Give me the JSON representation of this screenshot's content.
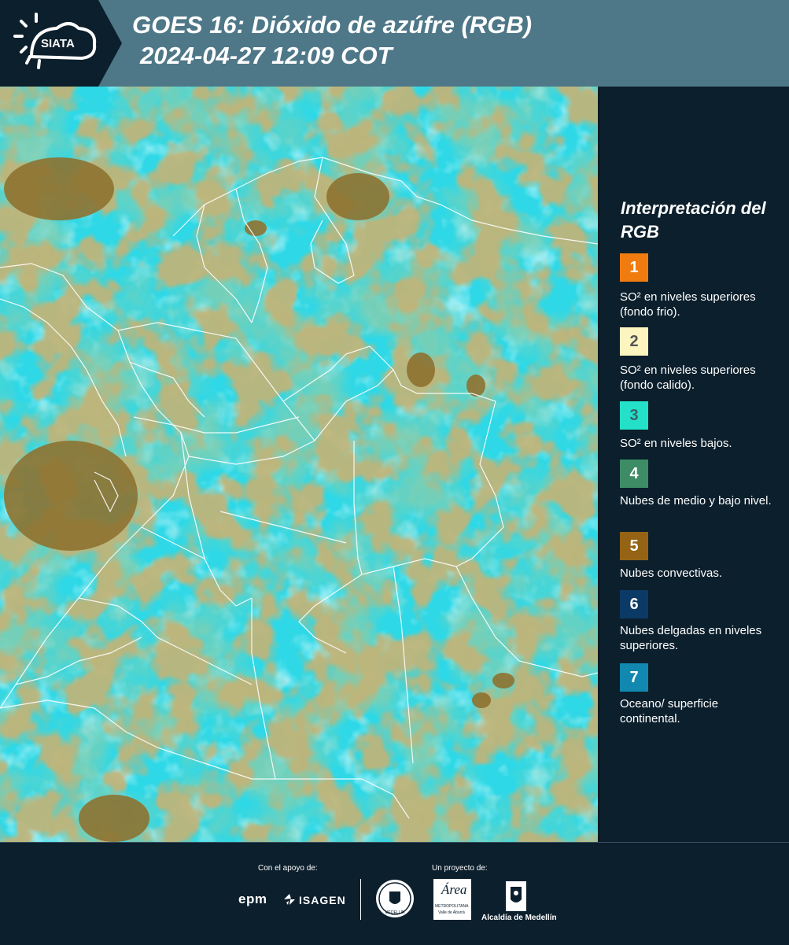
{
  "header": {
    "title_line1": "GOES 16: Dióxido de azúfre (RGB)",
    "title_line2": "2024-04-27 12:09 COT",
    "logo_text": "SIATA"
  },
  "legend": {
    "title": "Interpretación del RGB",
    "items": [
      {
        "number": "1",
        "label": "SO² en niveles superiores (fondo frio).",
        "color": "#f07c10",
        "number_color": "#ffffff"
      },
      {
        "number": "2",
        "label": "SO² en niveles superiores (fondo calido).",
        "color": "#fdf5c0",
        "number_color": "#555555"
      },
      {
        "number": "3",
        "label": "SO² en niveles bajos.",
        "color": "#25e0c8",
        "number_color": "#35656a"
      },
      {
        "number": "4",
        "label": "Nubes de medio y bajo nivel.",
        "color": "#3d8c66",
        "number_color": "#ffffff"
      },
      {
        "number": "5",
        "label": "Nubes convectivas.",
        "color": "#946414",
        "number_color": "#ffffff"
      },
      {
        "number": "6",
        "label": "Nubes delgadas en niveles superiores.",
        "color": "#0c3a66",
        "number_color": "#ffffff"
      },
      {
        "number": "7",
        "label": "Oceano/ superficie continental.",
        "color": "#1188b0",
        "number_color": "#ffffff"
      }
    ]
  },
  "colors": {
    "header_bg": "#4e7788",
    "logo_bg": "#0c1f2c",
    "panel_bg": "#0c1f2c",
    "map_cyan": "#2fd8e6",
    "map_green": "#4aa47c",
    "map_brown": "#8e7230"
  },
  "footer": {
    "support_caption": "Con el apoyo de:",
    "project_caption": "Un proyecto de:",
    "epm_label": "epm",
    "isagen_label": "ISAGEN",
    "medellin_seal_text": "MEDELLÍN",
    "area_label": "Área",
    "metropolitana_label": "METROPOLITANA",
    "valle_label": "Valle de Aburrá",
    "alcaldia_label": "Alcaldía de Medellín"
  }
}
